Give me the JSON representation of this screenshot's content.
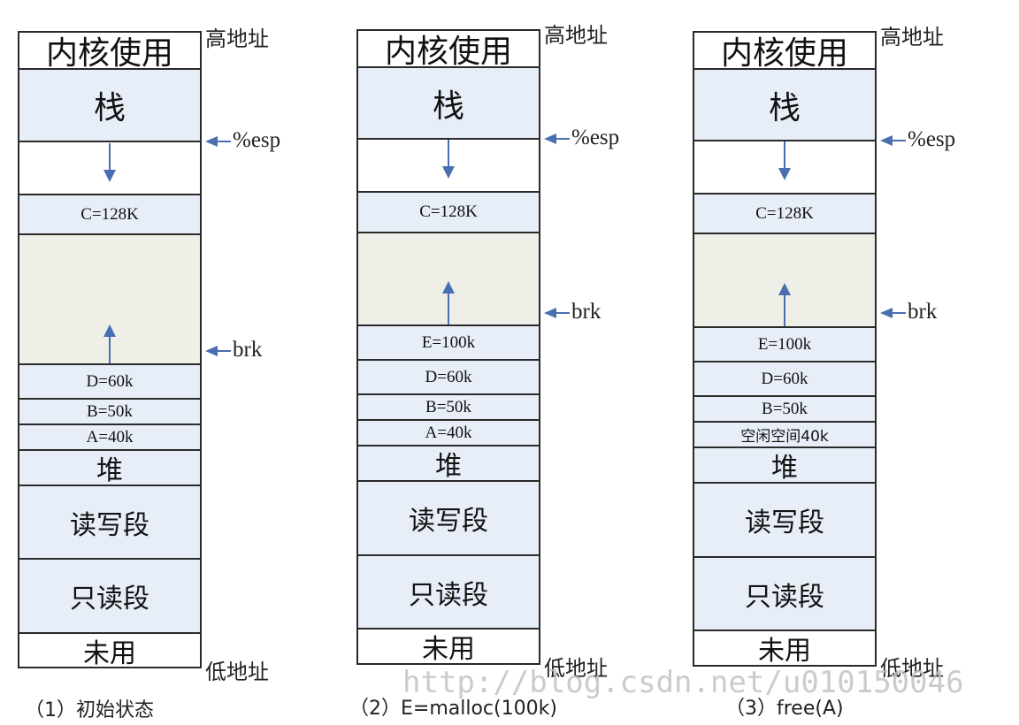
{
  "diagrams": [
    {
      "caption": "（1）初始状态",
      "segments": {
        "kernel": "内核使用",
        "stack": "栈",
        "c": "C=128K",
        "d": "D=60k",
        "b": "B=50k",
        "a": "A=40k",
        "heap": "堆",
        "rw": "读写段",
        "ro": "只读段",
        "unused": "未用"
      }
    },
    {
      "caption": "（2）E=malloc(100k)",
      "segments": {
        "kernel": "内核使用",
        "stack": "栈",
        "c": "C=128K",
        "e": "E=100k",
        "d": "D=60k",
        "b": "B=50k",
        "a": "A=40k",
        "heap": "堆",
        "rw": "读写段",
        "ro": "只读段",
        "unused": "未用"
      }
    },
    {
      "caption": "（3）free(A)",
      "segments": {
        "kernel": "内核使用",
        "stack": "栈",
        "c": "C=128K",
        "e": "E=100k",
        "d": "D=60k",
        "b": "B=50k",
        "free_a": "空闲空间40k",
        "heap": "堆",
        "rw": "读写段",
        "ro": "只读段",
        "unused": "未用"
      }
    }
  ],
  "labels": {
    "high_addr": "高地址",
    "low_addr": "低地址",
    "esp": "%esp",
    "brk": "brk"
  },
  "watermark": "http://blog.csdn.net/u010150046",
  "colors": {
    "segment_fill": "#e8eef8",
    "free_fill": "#eeefe6",
    "arrow": "#4a6fb0",
    "border": "#2a2a2a"
  }
}
